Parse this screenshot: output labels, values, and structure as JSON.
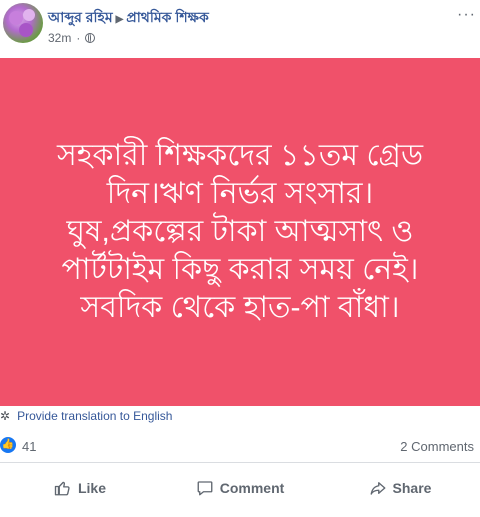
{
  "header": {
    "author": "আব্দুর রহিম",
    "group": "প্রাথমিক শিক্ষক",
    "separator": "▶",
    "time": "32m",
    "more": "···"
  },
  "post": {
    "background": "#f0516a",
    "lines": [
      "সহকারী শিক্ষকদের ১১তম গ্রেড",
      "দিন।ঋণ নির্ভর সংসার।",
      "ঘুষ,প্রকল্পের টাকা আত্মসাৎ ও",
      "পার্টটাইম কিছু করার সময় নেই।",
      "সবদিক থেকে হাত-পা বাঁধা।"
    ]
  },
  "translate": {
    "label": "Provide translation to English"
  },
  "reactions": {
    "likes": "41",
    "comments": "2 Comments"
  },
  "actions": {
    "like": "Like",
    "comment": "Comment",
    "share": "Share"
  },
  "colors": {
    "link": "#365899",
    "like_blue": "#1877f2",
    "muted": "#606770"
  },
  "icons": [
    "globe-icon",
    "more-icon",
    "gear-icon",
    "like-badge-icon",
    "thumbs-up-icon",
    "comment-icon",
    "share-icon"
  ]
}
